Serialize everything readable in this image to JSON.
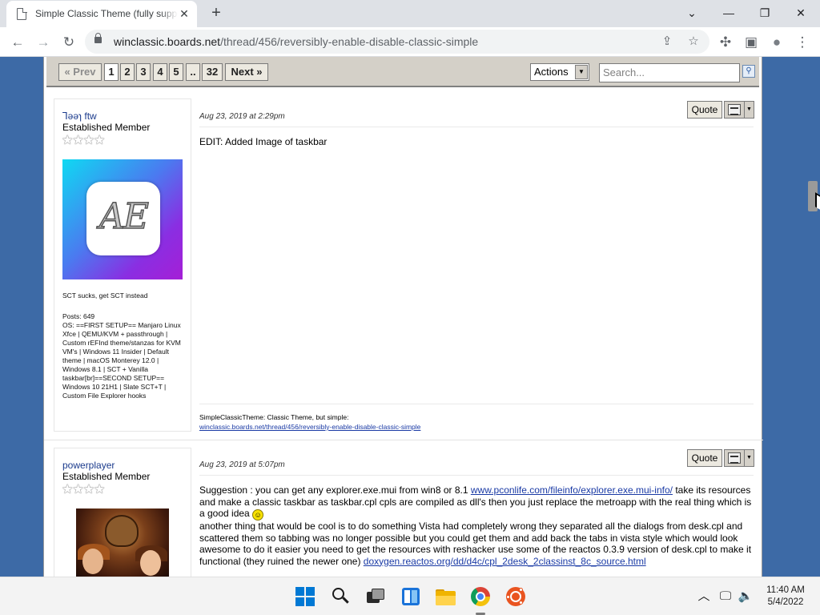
{
  "browser": {
    "tab_title": "Simple Classic Theme (fully supported)",
    "tab_close": "✕",
    "new_tab": "+",
    "window_controls": {
      "tabsearch": "⌄",
      "minimize": "—",
      "restore": "❐",
      "close": "✕"
    },
    "nav": {
      "back": "←",
      "forward": "→",
      "reload": "↻"
    },
    "url_host": "winclassic.boards.net",
    "url_path": "/thread/456/reversibly-enable-disable-classic-simple",
    "omnibox_icons": {
      "share": "⇪",
      "bookmark": "☆"
    },
    "toolbar_icons": {
      "extensions": "✣",
      "sidepanel": "▣",
      "profile": "●",
      "menu": "⋮"
    }
  },
  "forum": {
    "pagination": {
      "prev": "« Prev",
      "pages": [
        "1",
        "2",
        "3",
        "4",
        "5",
        "..",
        "32"
      ],
      "current": "1",
      "next": "Next »"
    },
    "actions_label": "Actions",
    "actions_arrow": "▼",
    "search_placeholder": "Search...",
    "search_go": "⚲",
    "posts": [
      {
        "username": "Ꞁəəɿ ftw",
        "rank": "Established Member",
        "stars": "★★★★",
        "avatar_text": "AE",
        "tagline": "SCT sucks, get SCT instead",
        "posts_count": "Posts: 649",
        "os": "OS: ==FIRST SETUP== Manjaro Linux Xfce | QEMU/KVM + passthrough | Custom rEFInd theme/stanzas for KVM VM's | Windows 11 Insider | Default theme | macOS Monterey 12.0 | Windows 8.1 | SCT + Vanilla taskbar[br]==SECOND SETUP== Windows 10 21H1 | Slate SCT+T | Custom File Explorer hooks",
        "date": "Aug 23, 2019 at 2:29pm",
        "quote_label": "Quote",
        "options_arrow": "▼",
        "body": "EDIT: Added Image of taskbar",
        "signature_title": "SimpleClassicTheme: Classic Theme, but simple:",
        "signature_link": "winclassic.boards.net/thread/456/reversibly-enable-disable-classic-simple"
      },
      {
        "username": "powerplayer",
        "rank": "Established Member",
        "stars": "★★★★",
        "date": "Aug 23, 2019 at 5:07pm",
        "quote_label": "Quote",
        "options_arrow": "▼",
        "body_part1": "Suggestion : you can get any explorer.exe.mui from win8 or 8.1 ",
        "body_link1": "www.pconlife.com/fileinfo/explorer.exe.mui-info/",
        "body_part2": " take its resources and make a classic taskbar as taskbar.cpl cpls are compiled as dll's then you just replace the metroapp with the real thing which is a good idea ",
        "smiley": "☺",
        "body_part3": "another thing that would be cool is to do something Vista had completely wrong they separated all the dialogs from desk.cpl and scattered them so tabbing was no longer possible but you could get them and add back the tabs in vista style which would look awesome to do it easier you need to get the resources with reshacker use some of the reactos 0.3.9 version  of desk.cpl to make it functional (they ruined the newer one) ",
        "body_link2": "doxygen.reactos.org/dd/d4c/cpl_2desk_2classinst_8c_source.html"
      }
    ]
  },
  "taskbar": {
    "tray": {
      "chevron": "︿",
      "network": "🖵",
      "volume": "🔈"
    },
    "time": "11:40 AM",
    "date": "5/4/2022"
  }
}
